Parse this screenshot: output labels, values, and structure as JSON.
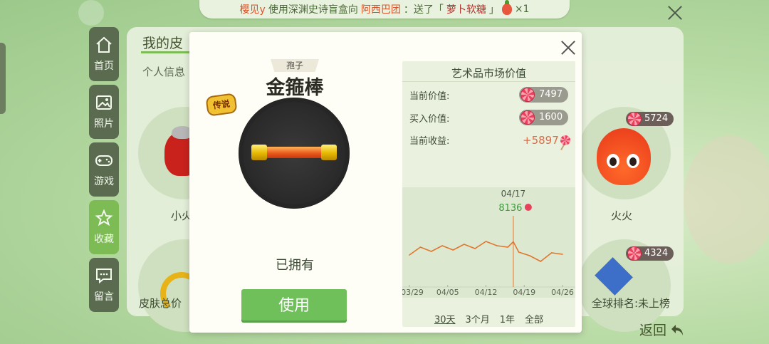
{
  "banner": {
    "user": "樱见y",
    "action": "使用深渊史诗盲盒向",
    "target": "阿西巴团",
    "gift_text": "：送了「",
    "gift_item": "萝卜软糖",
    "gift_close": "」",
    "count": "×1"
  },
  "nav": {
    "items": [
      {
        "label": "首页",
        "icon": "home-icon",
        "active": false
      },
      {
        "label": "照片",
        "icon": "photo-icon",
        "active": false
      },
      {
        "label": "游戏",
        "icon": "gamepad-icon",
        "active": false
      },
      {
        "label": "收藏",
        "icon": "star-icon",
        "active": true
      },
      {
        "label": "留言",
        "icon": "message-icon",
        "active": false
      }
    ]
  },
  "background": {
    "title": "我的皮",
    "tab_personal": "个人信息",
    "skin_left_label": "小火",
    "skin_right_label": "火火",
    "skin_right_price": "5724",
    "skin_right2_price": "4324",
    "total_value_label": "皮肤总价",
    "global_rank": "全球排名:未上榜",
    "back_label": "返回"
  },
  "modal": {
    "category": "孢子",
    "item_name": "金箍棒",
    "rarity_badge": "传说",
    "owned_text": "已拥有",
    "use_button": "使用",
    "market": {
      "title": "艺术品市场价值",
      "current_value_label": "当前价值:",
      "current_value": "7497",
      "buy_value_label": "买入价值:",
      "buy_value": "1600",
      "profit_label": "当前收益:",
      "profit": "+5897",
      "tooltip_date": "04/17",
      "tooltip_value": "8136",
      "range_tabs": [
        "30天",
        "3个月",
        "1年",
        "全部"
      ],
      "active_range": "30天"
    }
  },
  "chart_data": {
    "type": "line",
    "x": [
      "03/29",
      "03/31",
      "04/02",
      "04/04",
      "04/06",
      "04/08",
      "04/10",
      "04/12",
      "04/14",
      "04/16",
      "04/17",
      "04/18",
      "04/20",
      "04/22",
      "04/24",
      "04/26"
    ],
    "values": [
      7950,
      8060,
      8000,
      8080,
      8020,
      8100,
      8040,
      8140,
      8080,
      8060,
      8136,
      7990,
      7940,
      7860,
      7980,
      7960
    ],
    "tick_labels": [
      "03/29",
      "04/05",
      "04/12",
      "04/19",
      "04/26"
    ],
    "highlight": {
      "x": "04/17",
      "value": 8136
    },
    "line_color": "#e0762f",
    "cursor_color": "#e0762f"
  }
}
